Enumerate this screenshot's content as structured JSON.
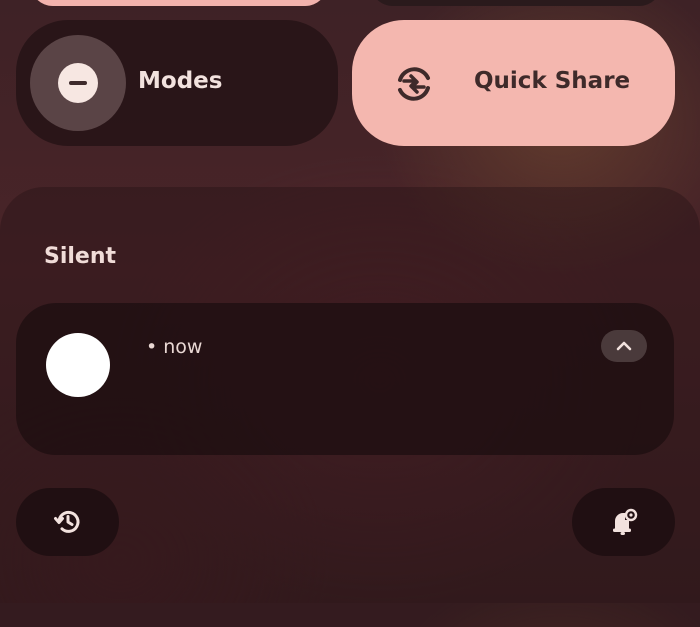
{
  "quick_settings": {
    "modes": {
      "label": "Modes",
      "icon": "minus-circle-icon"
    },
    "quick_share": {
      "label": "Quick Share",
      "icon": "quick-share-icon"
    }
  },
  "notifications": {
    "section_title": "Silent",
    "items": [
      {
        "time": "• now",
        "avatar": "white-circle-avatar",
        "expand_icon": "chevron-up-icon"
      }
    ]
  },
  "footer": {
    "history_icon": "history-icon",
    "settings_icon": "notification-settings-icon"
  },
  "colors": {
    "accent_tile": "#f4b7af",
    "dark_tile": "#221214",
    "text_light": "#f2e2de",
    "text_dark": "#3e2a2a"
  }
}
